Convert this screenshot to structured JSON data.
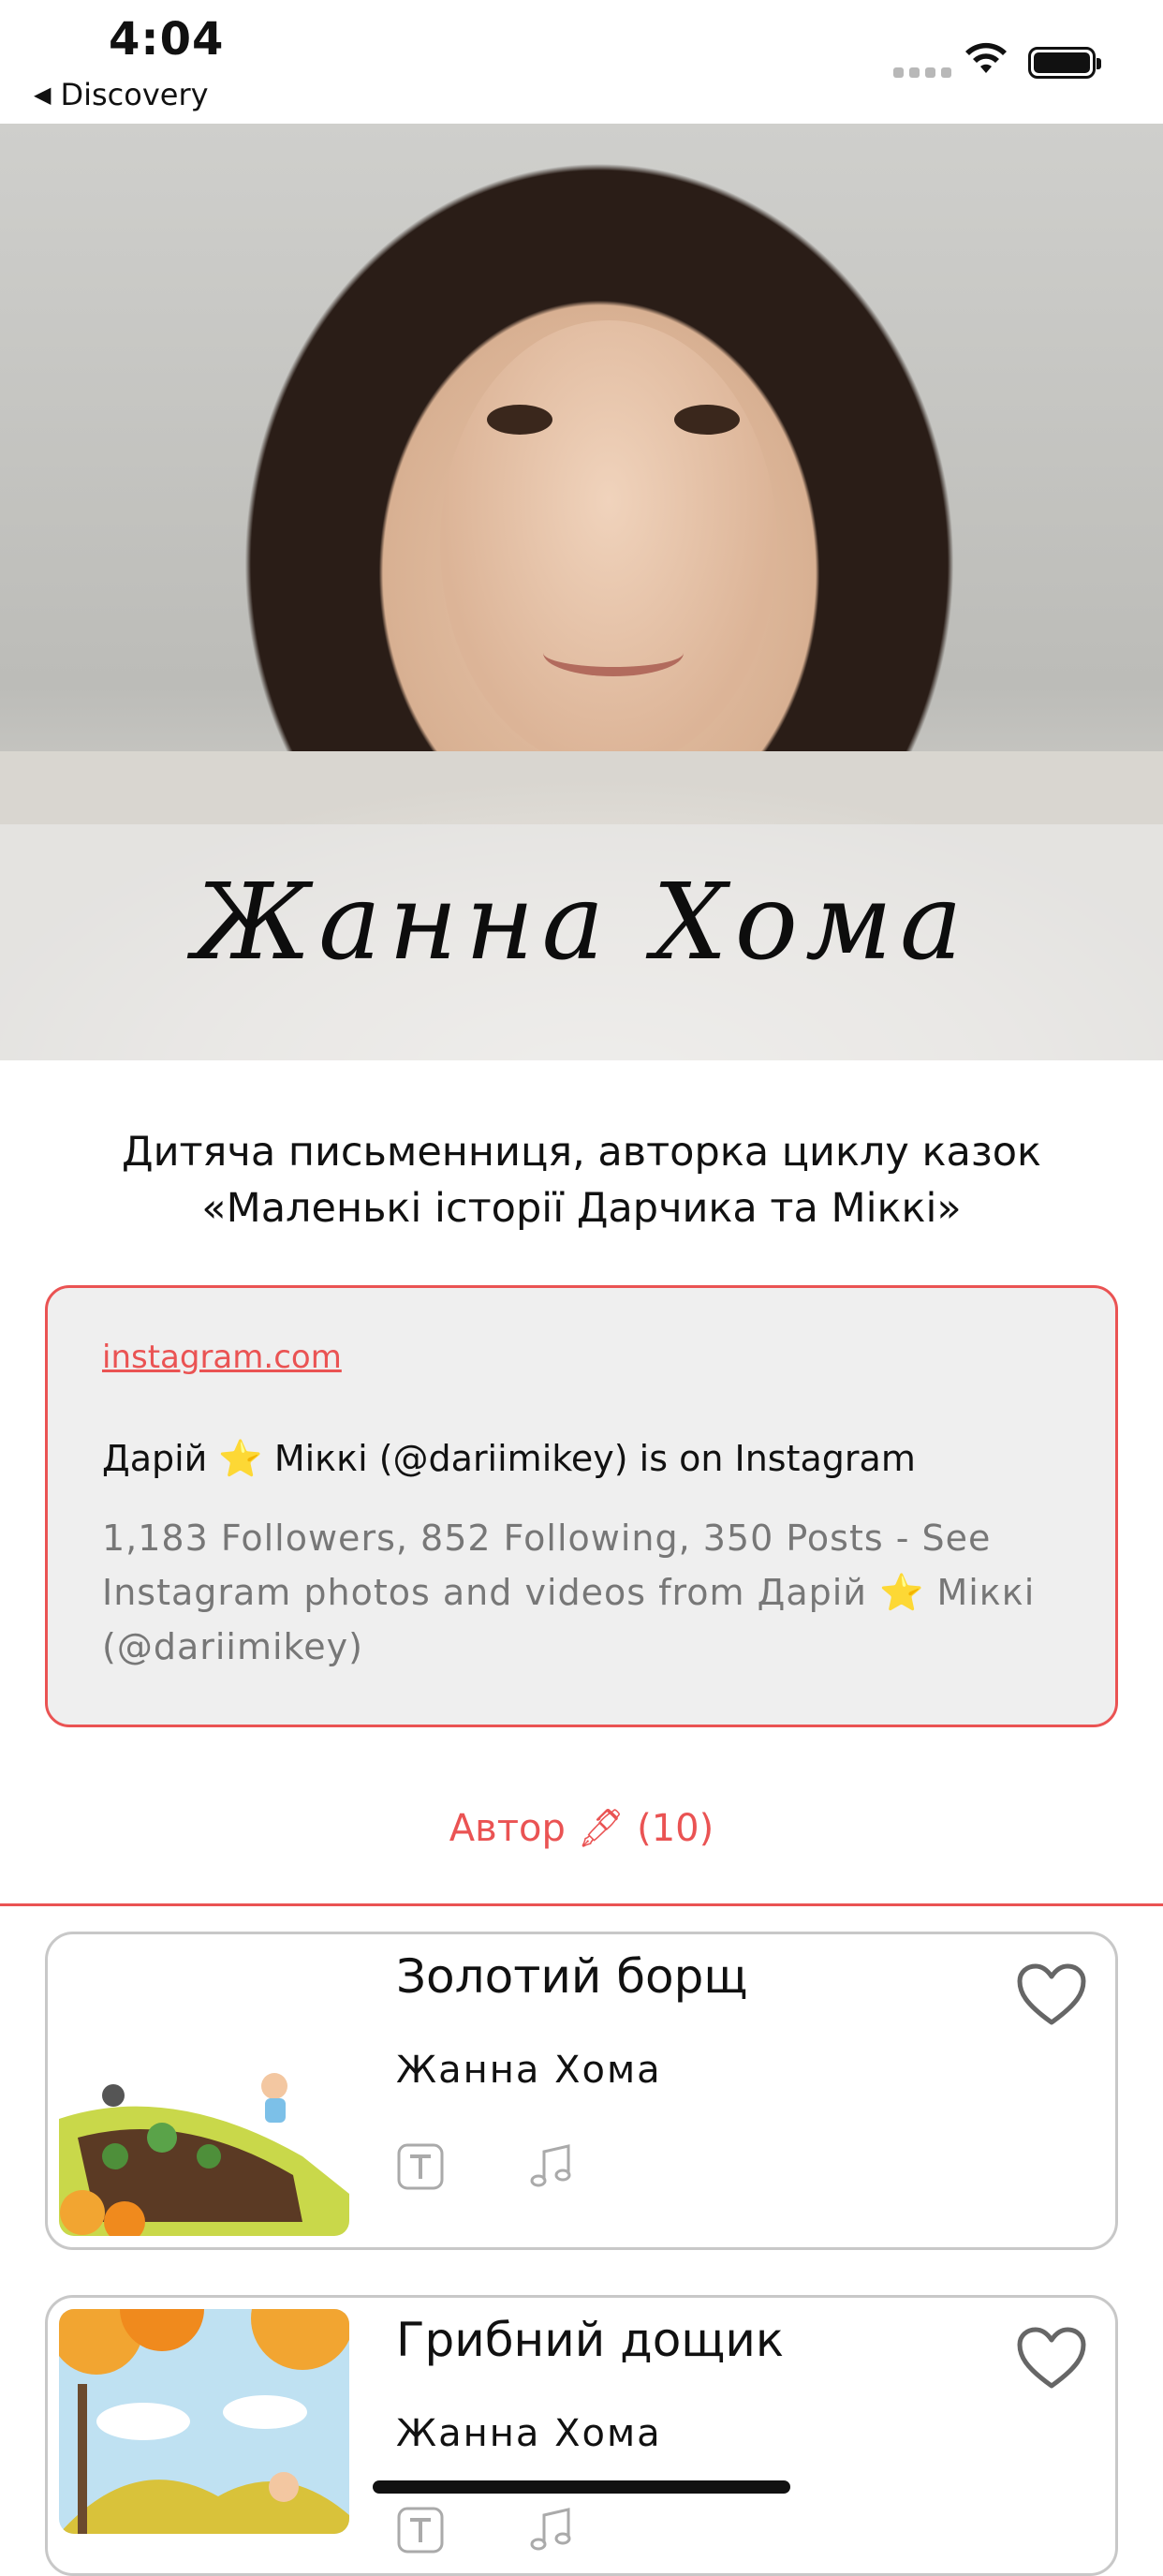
{
  "status_bar": {
    "time": "4:04",
    "back_label": "Discovery"
  },
  "author": {
    "name": "Жанна Хома",
    "bio": "Дитяча письменниця, авторка циклу казок «Маленькі історії Дарчика та Міккі»"
  },
  "link_preview": {
    "domain": "instagram.com",
    "title": "Дарій ⭐ Міккі (@dariimikey) is on Instagram",
    "description": "1,183 Followers, 852 Following, 350 Posts - See Instagram photos and videos from Дарій ⭐ Міккі (@dariimikey)"
  },
  "section": {
    "label": "Автор 🖋 (10)"
  },
  "stories": [
    {
      "title": "Золотий борщ",
      "author": "Жанна Хома"
    },
    {
      "title": "Грибний дощик",
      "author": "Жанна Хома"
    }
  ],
  "colors": {
    "accent": "#ea5353",
    "card_bg": "#efefef",
    "muted_text": "#777777"
  },
  "icons": [
    "back-chevron-icon",
    "wifi-icon",
    "battery-icon",
    "heart-icon",
    "text-icon",
    "music-note-icon"
  ]
}
